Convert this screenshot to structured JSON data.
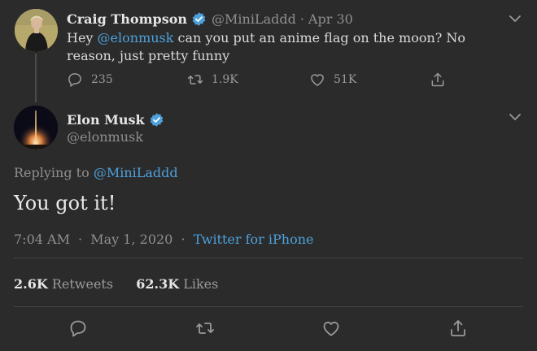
{
  "parent_tweet": {
    "name": "Craig Thompson",
    "handle": "@MiniLaddd",
    "separator": "·",
    "date": "Apr 30",
    "text_before": "Hey ",
    "mention": "@elonmusk",
    "text_after": " can you put an anime flag on the moon? No reason, just pretty funny",
    "replies": "235",
    "retweets": "1.9K",
    "likes": "51K"
  },
  "main_tweet": {
    "name": "Elon Musk",
    "handle": "@elonmusk",
    "replying_to_label": "Replying to ",
    "replying_to_handle": "@MiniLaddd",
    "text": "You got it!",
    "time": "7:04 AM",
    "date": "May 1, 2020",
    "source": "Twitter for iPhone",
    "retweets_count": "2.6K",
    "retweets_label": "Retweets",
    "likes_count": "62.3K",
    "likes_label": "Likes"
  },
  "icons": [
    "verified-badge-icon",
    "chevron-down-icon",
    "reply-icon",
    "retweet-icon",
    "like-icon",
    "share-icon"
  ],
  "colors": {
    "background": "#2b2b2b",
    "accent": "#4ea1dc",
    "muted": "#8f8f8f"
  }
}
